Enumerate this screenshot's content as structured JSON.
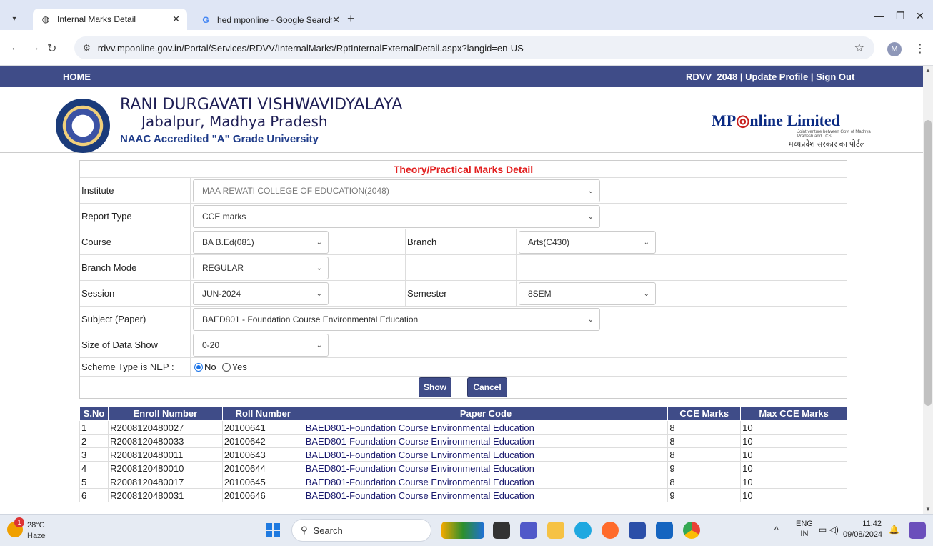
{
  "browser": {
    "tabs": [
      {
        "title": "Internal Marks Detail",
        "active": true
      },
      {
        "title": "hed mponline - Google Search",
        "active": false
      }
    ],
    "url": "rdvv.mponline.gov.in/Portal/Services/RDVV/InternalMarks/RptInternalExternalDetail.aspx?langid=en-US",
    "profile_initial": "M"
  },
  "nav": {
    "home": "HOME",
    "user_links": "RDVV_2048 | Update Profile | Sign Out"
  },
  "header": {
    "university_name": "RANI DURGAVATI VISHWAVIDYALAYA",
    "university_city": "Jabalpur, Madhya Pradesh",
    "accreditation": "NAAC Accredited \"A\" Grade University",
    "partner_logo_text": "MPOnline Limited",
    "partner_logo_mp": "MP",
    "partner_logo_rest": "nline Limited",
    "partner_tagline": "Joint venture between Govt of Madhya Pradesh and TCS",
    "partner_hindi": "मध्यप्रदेश सरकार का पोर्टल"
  },
  "form": {
    "title": "Theory/Practical Marks Detail",
    "institute_label": "Institute",
    "institute_value": "MAA REWATI COLLEGE OF EDUCATION(2048)",
    "report_type_label": "Report Type",
    "report_type_value": "CCE marks",
    "course_label": "Course",
    "course_value": "BA B.Ed(081)",
    "branch_label": "Branch",
    "branch_value": "Arts(C430)",
    "branch_mode_label": "Branch Mode",
    "branch_mode_value": "REGULAR",
    "session_label": "Session",
    "session_value": "JUN-2024",
    "semester_label": "Semester",
    "semester_value": "8SEM",
    "subject_label": "Subject (Paper)",
    "subject_value": "BAED801 - Foundation Course Environmental Education",
    "size_label": "Size of Data Show",
    "size_value": "0-20",
    "nep_label": "Scheme Type is NEP :",
    "nep_no": "No",
    "nep_yes": "Yes",
    "show_button": "Show",
    "cancel_button": "Cancel"
  },
  "table": {
    "headers": [
      "S.No",
      "Enroll Number",
      "Roll Number",
      "Paper Code",
      "CCE Marks",
      "Max CCE Marks"
    ],
    "rows": [
      [
        "1",
        "R2008120480027",
        "20100641",
        "BAED801-Foundation Course Environmental Education",
        "8",
        "10"
      ],
      [
        "2",
        "R2008120480033",
        "20100642",
        "BAED801-Foundation Course Environmental Education",
        "8",
        "10"
      ],
      [
        "3",
        "R2008120480011",
        "20100643",
        "BAED801-Foundation Course Environmental Education",
        "8",
        "10"
      ],
      [
        "4",
        "R2008120480010",
        "20100644",
        "BAED801-Foundation Course Environmental Education",
        "9",
        "10"
      ],
      [
        "5",
        "R2008120480017",
        "20100645",
        "BAED801-Foundation Course Environmental Education",
        "8",
        "10"
      ],
      [
        "6",
        "R2008120480031",
        "20100646",
        "BAED801-Foundation Course Environmental Education",
        "9",
        "10"
      ]
    ]
  },
  "taskbar": {
    "weather_badge": "1",
    "temperature": "28°C",
    "condition": "Haze",
    "search_placeholder": "Search",
    "lang_top": "ENG",
    "lang_bottom": "IN",
    "time": "11:42",
    "date": "09/08/2024"
  },
  "colors": {
    "nav_bg": "#3f4c88",
    "title_red": "#e21f1f",
    "brand_blue": "#0a2a82"
  }
}
